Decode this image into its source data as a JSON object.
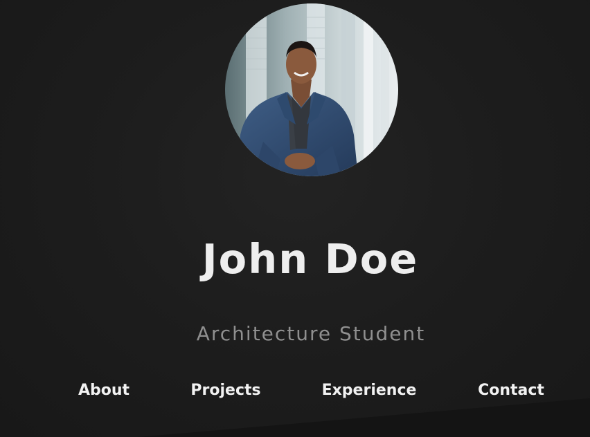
{
  "profile": {
    "name": "John Doe",
    "title": "Architecture Student"
  },
  "nav": {
    "items": [
      {
        "label": "About"
      },
      {
        "label": "Projects"
      },
      {
        "label": "Experience"
      },
      {
        "label": "Contact"
      }
    ]
  },
  "colors": {
    "background": "#1c1c1c",
    "name_text": "#eeeeee",
    "subtitle_text": "#8f8f8f",
    "nav_text": "#f2f2f2"
  }
}
